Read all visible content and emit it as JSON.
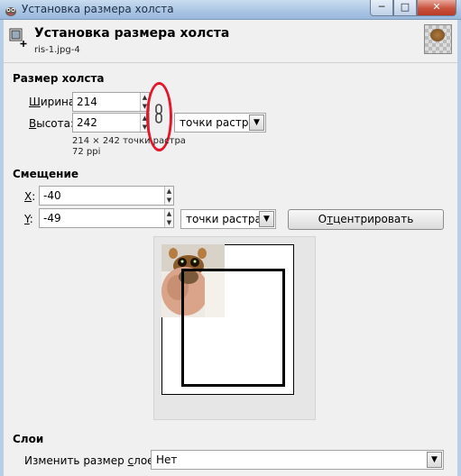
{
  "window": {
    "title": "Установка размера холста",
    "min_glyph": "─",
    "max_glyph": "□",
    "close_glyph": "✕"
  },
  "header": {
    "title": "Установка размера холста",
    "subtitle": "ris-1.jpg-4"
  },
  "canvas_size": {
    "section_label": "Размер холста",
    "width_label_u": "Ш",
    "width_label_rest": "ирина:",
    "width_value": "214",
    "height_label_u": "В",
    "height_label_rest": "ысота:",
    "height_value": "242",
    "unit": "точки растра",
    "info_line1": "214 × 242 точки растра",
    "info_line2": "72 ppi",
    "chain_linked": true
  },
  "offset": {
    "section_label": "Смещение",
    "x_label_u": "X",
    "x_label_rest": ":",
    "x_value": "-40",
    "y_label_u": "Y",
    "y_label_rest": ":",
    "y_value": "-49",
    "unit": "точки растра",
    "center_button_pre": "О",
    "center_button_u": "т",
    "center_button_rest": "центрировать"
  },
  "layers": {
    "section_label": "Слои",
    "resize_label_pre": "Изменить размер ",
    "resize_label_u": "с",
    "resize_label_rest": "лоев:",
    "resize_value": "Нет"
  },
  "colors": {
    "highlight": "#e3162a",
    "title_bar": "#a9c4e3",
    "close_button": "#c9523d"
  },
  "icons": {
    "app": "gimp-icon",
    "header": "canvas-size-icon",
    "chain": "chain-link-icon",
    "dropdown": "chevron-down-icon",
    "spin_up": "arrow-up-icon",
    "spin_down": "arrow-down-icon"
  }
}
